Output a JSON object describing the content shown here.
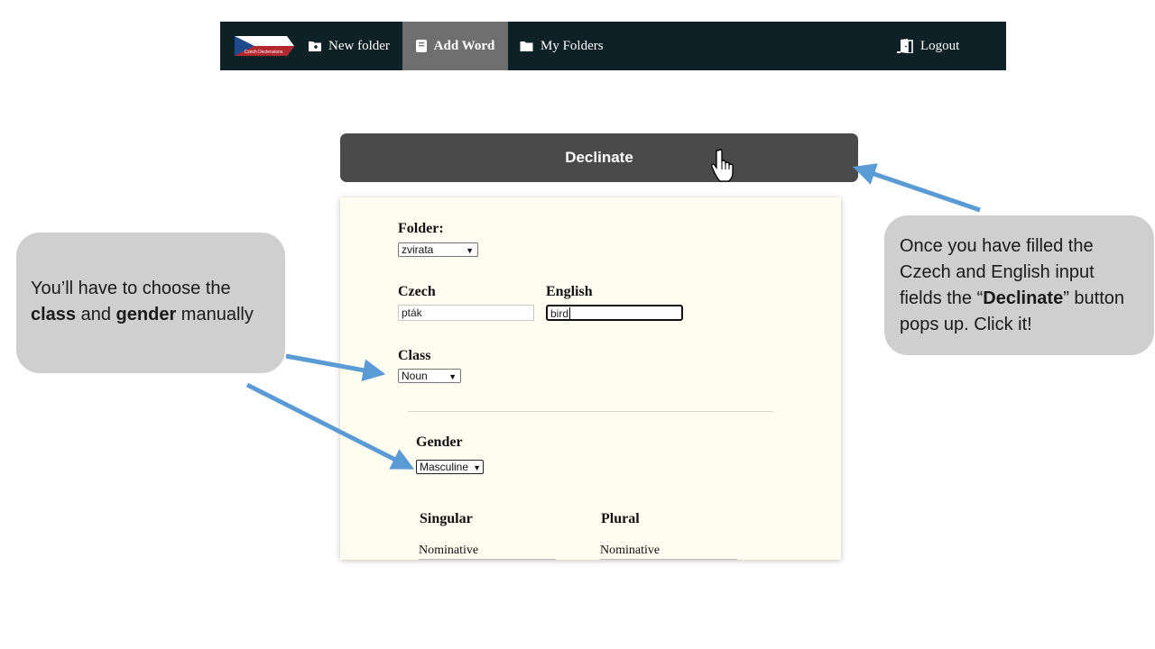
{
  "navbar": {
    "logo_alt": "Czech Declensions",
    "items": [
      {
        "label": "New folder",
        "icon": "folder-plus-icon"
      },
      {
        "label": "Add Word",
        "icon": "book-icon",
        "active": true
      },
      {
        "label": "My Folders",
        "icon": "folder-icon"
      },
      {
        "label": "Logout",
        "icon": "door-icon"
      }
    ]
  },
  "declinate_button": {
    "label": "Declinate"
  },
  "form": {
    "folder": {
      "label": "Folder:",
      "value": "zvirata"
    },
    "czech": {
      "label": "Czech",
      "value": "pták"
    },
    "english": {
      "label": "English",
      "value": "bird"
    },
    "class": {
      "label": "Class",
      "value": "Noun"
    },
    "gender": {
      "label": "Gender",
      "value": "Masculine"
    },
    "singular": {
      "label": "Singular",
      "first_case": "Nominative"
    },
    "plural": {
      "label": "Plural",
      "first_case": "Nominative"
    }
  },
  "callouts": {
    "left": {
      "line1": "You’ll have to choose the",
      "bold1": "class",
      "mid": " and ",
      "bold2": "gender",
      "tail": " manually"
    },
    "right": {
      "pre": "Once you have filled the Czech and English input fields the “",
      "bold": "Declinate",
      "post": "” button pops up. Click it!"
    }
  },
  "colors": {
    "navbar_bg": "#0e2126",
    "active_tab_bg": "#6f6f6f",
    "button_bg": "#4a4a4a",
    "panel_bg": "#fdfdf0",
    "callout_bg": "#d0cfcf",
    "arrow": "#5b9bd5"
  }
}
